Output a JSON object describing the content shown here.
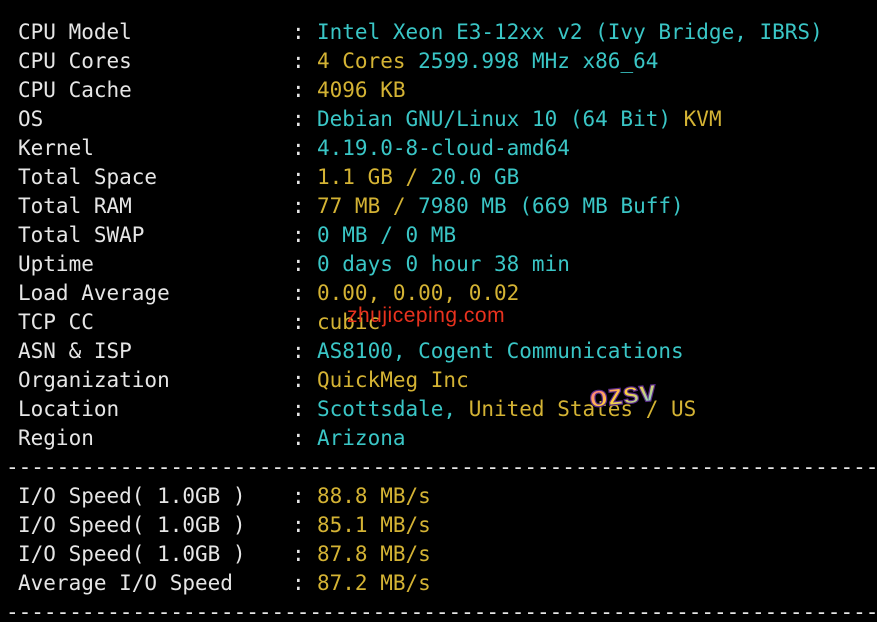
{
  "system_info": [
    {
      "label": "CPU Model",
      "parts": [
        {
          "text": "Intel Xeon E3-12xx v2 (Ivy Bridge, IBRS)",
          "color": "cyan"
        }
      ]
    },
    {
      "label": "CPU Cores",
      "parts": [
        {
          "text": "4 Cores ",
          "color": "yellow"
        },
        {
          "text": "2599.998 MHz x86_64",
          "color": "cyan"
        }
      ]
    },
    {
      "label": "CPU Cache",
      "parts": [
        {
          "text": "4096 KB",
          "color": "yellow"
        }
      ]
    },
    {
      "label": "OS",
      "parts": [
        {
          "text": "Debian GNU/Linux 10 (64 Bit) ",
          "color": "cyan"
        },
        {
          "text": "KVM",
          "color": "yellow"
        }
      ]
    },
    {
      "label": "Kernel",
      "parts": [
        {
          "text": "4.19.0-8-cloud-amd64",
          "color": "cyan"
        }
      ]
    },
    {
      "label": "Total Space",
      "parts": [
        {
          "text": "1.1 GB / ",
          "color": "yellow"
        },
        {
          "text": "20.0 GB",
          "color": "cyan"
        }
      ]
    },
    {
      "label": "Total RAM",
      "parts": [
        {
          "text": "77 MB / ",
          "color": "yellow"
        },
        {
          "text": "7980 MB ",
          "color": "cyan"
        },
        {
          "text": "(669 MB Buff)",
          "color": "cyan"
        }
      ]
    },
    {
      "label": "Total SWAP",
      "parts": [
        {
          "text": "0 MB / ",
          "color": "cyan"
        },
        {
          "text": "0 MB",
          "color": "cyan"
        }
      ]
    },
    {
      "label": "Uptime",
      "parts": [
        {
          "text": "0 days 0 hour 38 min",
          "color": "cyan"
        }
      ]
    },
    {
      "label": "Load Average",
      "parts": [
        {
          "text": "0.00, 0.00, 0.02",
          "color": "yellow"
        }
      ]
    },
    {
      "label": "TCP CC",
      "parts": [
        {
          "text": "cubic",
          "color": "yellow"
        }
      ]
    },
    {
      "label": "ASN & ISP",
      "parts": [
        {
          "text": "AS8100, Cogent Communications",
          "color": "cyan"
        }
      ]
    },
    {
      "label": "Organization",
      "parts": [
        {
          "text": "QuickMeg Inc",
          "color": "yellow"
        }
      ]
    },
    {
      "label": "Location",
      "parts": [
        {
          "text": "Scottsdale, ",
          "color": "cyan"
        },
        {
          "text": "United States / US",
          "color": "yellow"
        }
      ]
    },
    {
      "label": "Region",
      "parts": [
        {
          "text": "Arizona",
          "color": "cyan"
        }
      ]
    }
  ],
  "io_info": [
    {
      "label": "I/O Speed( 1.0GB )",
      "parts": [
        {
          "text": "88.8 MB/s",
          "color": "yellow"
        }
      ]
    },
    {
      "label": "I/O Speed( 1.0GB )",
      "parts": [
        {
          "text": "85.1 MB/s",
          "color": "yellow"
        }
      ]
    },
    {
      "label": "I/O Speed( 1.0GB )",
      "parts": [
        {
          "text": "87.8 MB/s",
          "color": "yellow"
        }
      ]
    },
    {
      "label": "Average I/O Speed",
      "parts": [
        {
          "text": "87.2 MB/s",
          "color": "yellow"
        }
      ]
    }
  ],
  "separator_text": "------------------------------------------------------------------------------------------",
  "colon": ":",
  "watermark_text": "zhujiceping.com",
  "logo_text": "ozsv",
  "colors": {
    "background": "#000000",
    "label": "#e6e6e6",
    "cyan": "#3ac6c6",
    "yellow": "#d4b334",
    "watermark": "#e8321e"
  }
}
